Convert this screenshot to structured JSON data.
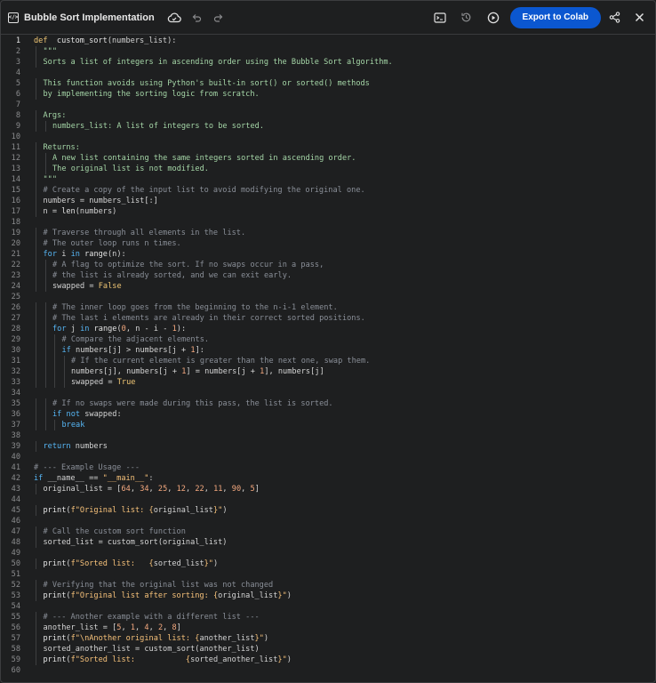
{
  "header": {
    "app_icon_glyph": "</>",
    "title": "Bubble Sort Implementation",
    "export_label": "Export to Colab",
    "icons": [
      "code-panel-icon",
      "cloud-sync-icon",
      "undo-icon",
      "redo-icon",
      "terminal-icon",
      "history-icon",
      "run-icon",
      "share-icon",
      "close-icon"
    ]
  },
  "colors": {
    "accent": "#0b57d0",
    "background": "#1e1f20",
    "keyword": "#f0c674",
    "comment": "#8a8f98",
    "docstring": "#a5d6a7",
    "number": "#f5a97f"
  },
  "editor": {
    "active_line": 1,
    "lines": [
      {
        "indent": 0,
        "tokens": [
          [
            "kw",
            "def"
          ],
          [
            "",
            "  "
          ],
          [
            "fn",
            "custom_sort"
          ],
          [
            "",
            "(numbers_list):"
          ]
        ]
      },
      {
        "indent": 1,
        "tokens": [
          [
            "doc",
            "\"\"\""
          ]
        ]
      },
      {
        "indent": 1,
        "tokens": [
          [
            "doc",
            "Sorts a list of integers in ascending order using the Bubble Sort algorithm."
          ]
        ]
      },
      {
        "indent": 0,
        "tokens": []
      },
      {
        "indent": 1,
        "tokens": [
          [
            "doc",
            "This function avoids using Python's built-in sort() or sorted() methods"
          ]
        ]
      },
      {
        "indent": 1,
        "tokens": [
          [
            "doc",
            "by implementing the sorting logic from scratch."
          ]
        ]
      },
      {
        "indent": 0,
        "tokens": []
      },
      {
        "indent": 1,
        "tokens": [
          [
            "doc",
            "Args:"
          ]
        ]
      },
      {
        "indent": 2,
        "tokens": [
          [
            "doc",
            "numbers_list: A list of integers to be sorted."
          ]
        ]
      },
      {
        "indent": 0,
        "tokens": []
      },
      {
        "indent": 1,
        "tokens": [
          [
            "doc",
            "Returns:"
          ]
        ]
      },
      {
        "indent": 2,
        "tokens": [
          [
            "doc",
            "A new list containing the same integers sorted in ascending order."
          ]
        ]
      },
      {
        "indent": 2,
        "tokens": [
          [
            "doc",
            "The original list is not modified."
          ]
        ]
      },
      {
        "indent": 1,
        "tokens": [
          [
            "doc",
            "\"\"\""
          ]
        ]
      },
      {
        "indent": 1,
        "tokens": [
          [
            "cm",
            "# Create a copy of the input list to avoid modifying the original one."
          ]
        ]
      },
      {
        "indent": 1,
        "tokens": [
          [
            "",
            "numbers = numbers_list[:]"
          ]
        ]
      },
      {
        "indent": 1,
        "tokens": [
          [
            "",
            "n = "
          ],
          [
            "fn",
            "len"
          ],
          [
            "",
            "(numbers)"
          ]
        ]
      },
      {
        "indent": 0,
        "tokens": []
      },
      {
        "indent": 1,
        "tokens": [
          [
            "cm",
            "# Traverse through all elements in the list."
          ]
        ]
      },
      {
        "indent": 1,
        "tokens": [
          [
            "cm",
            "# The outer loop runs n times."
          ]
        ]
      },
      {
        "indent": 1,
        "tokens": [
          [
            "kw2",
            "for"
          ],
          [
            "",
            " i "
          ],
          [
            "kw2",
            "in"
          ],
          [
            "",
            " "
          ],
          [
            "fn",
            "range"
          ],
          [
            "",
            "(n):"
          ]
        ]
      },
      {
        "indent": 2,
        "tokens": [
          [
            "cm",
            "# A flag to optimize the sort. If no swaps occur in a pass,"
          ]
        ]
      },
      {
        "indent": 2,
        "tokens": [
          [
            "cm",
            "# the list is already sorted, and we can exit early."
          ]
        ]
      },
      {
        "indent": 2,
        "tokens": [
          [
            "",
            "swapped = "
          ],
          [
            "kw",
            "False"
          ]
        ]
      },
      {
        "indent": 0,
        "tokens": []
      },
      {
        "indent": 2,
        "tokens": [
          [
            "cm",
            "# The inner loop goes from the beginning to the n-i-1 element."
          ]
        ]
      },
      {
        "indent": 2,
        "tokens": [
          [
            "cm",
            "# The last i elements are already in their correct sorted positions."
          ]
        ]
      },
      {
        "indent": 2,
        "tokens": [
          [
            "kw2",
            "for"
          ],
          [
            "",
            " j "
          ],
          [
            "kw2",
            "in"
          ],
          [
            "",
            " "
          ],
          [
            "fn",
            "range"
          ],
          [
            "",
            "("
          ],
          [
            "nm",
            "0"
          ],
          [
            "",
            ", n - i - "
          ],
          [
            "nm",
            "1"
          ],
          [
            "",
            "):"
          ]
        ]
      },
      {
        "indent": 3,
        "tokens": [
          [
            "cm",
            "# Compare the adjacent elements."
          ]
        ]
      },
      {
        "indent": 3,
        "tokens": [
          [
            "kw2",
            "if"
          ],
          [
            "",
            " numbers[j] > numbers[j + "
          ],
          [
            "nm",
            "1"
          ],
          [
            "",
            "]:"
          ]
        ]
      },
      {
        "indent": 4,
        "tokens": [
          [
            "cm",
            "# If the current element is greater than the next one, swap them."
          ]
        ]
      },
      {
        "indent": 4,
        "tokens": [
          [
            "",
            "numbers[j], numbers[j + "
          ],
          [
            "nm",
            "1"
          ],
          [
            "",
            "] = numbers[j + "
          ],
          [
            "nm",
            "1"
          ],
          [
            "",
            "], numbers[j]"
          ]
        ]
      },
      {
        "indent": 4,
        "tokens": [
          [
            "",
            "swapped = "
          ],
          [
            "kw",
            "True"
          ]
        ]
      },
      {
        "indent": 0,
        "tokens": []
      },
      {
        "indent": 2,
        "tokens": [
          [
            "cm",
            "# If no swaps were made during this pass, the list is sorted."
          ]
        ]
      },
      {
        "indent": 2,
        "tokens": [
          [
            "kw2",
            "if not"
          ],
          [
            "",
            " swapped:"
          ]
        ]
      },
      {
        "indent": 3,
        "tokens": [
          [
            "kw2",
            "break"
          ]
        ]
      },
      {
        "indent": 0,
        "tokens": []
      },
      {
        "indent": 1,
        "tokens": [
          [
            "kw2",
            "return"
          ],
          [
            "",
            " numbers"
          ]
        ]
      },
      {
        "indent": 0,
        "tokens": []
      },
      {
        "indent": 0,
        "tokens": [
          [
            "cm",
            "# --- Example Usage ---"
          ]
        ]
      },
      {
        "indent": 0,
        "tokens": [
          [
            "kw2",
            "if"
          ],
          [
            "",
            " __name__ == "
          ],
          [
            "st",
            "\"__main__\""
          ],
          [
            "",
            ":"
          ]
        ]
      },
      {
        "indent": 1,
        "tokens": [
          [
            "",
            "original_list = ["
          ],
          [
            "nm",
            "64"
          ],
          [
            "",
            ", "
          ],
          [
            "nm",
            "34"
          ],
          [
            "",
            ", "
          ],
          [
            "nm",
            "25"
          ],
          [
            "",
            ", "
          ],
          [
            "nm",
            "12"
          ],
          [
            "",
            ", "
          ],
          [
            "nm",
            "22"
          ],
          [
            "",
            ", "
          ],
          [
            "nm",
            "11"
          ],
          [
            "",
            ", "
          ],
          [
            "nm",
            "90"
          ],
          [
            "",
            ", "
          ],
          [
            "nm",
            "5"
          ],
          [
            "",
            "]"
          ]
        ]
      },
      {
        "indent": 0,
        "tokens": []
      },
      {
        "indent": 1,
        "tokens": [
          [
            "fn",
            "print"
          ],
          [
            "",
            "("
          ],
          [
            "st",
            "f\"Original list: {"
          ],
          [
            "",
            "original_list"
          ],
          [
            "st",
            "}\""
          ],
          [
            "",
            ")"
          ]
        ]
      },
      {
        "indent": 0,
        "tokens": []
      },
      {
        "indent": 1,
        "tokens": [
          [
            "cm",
            "# Call the custom sort function"
          ]
        ]
      },
      {
        "indent": 1,
        "tokens": [
          [
            "",
            "sorted_list = custom_sort(original_list)"
          ]
        ]
      },
      {
        "indent": 0,
        "tokens": []
      },
      {
        "indent": 1,
        "tokens": [
          [
            "fn",
            "print"
          ],
          [
            "",
            "("
          ],
          [
            "st",
            "f\"Sorted list:   {"
          ],
          [
            "",
            "sorted_list"
          ],
          [
            "st",
            "}\""
          ],
          [
            "",
            ")"
          ]
        ]
      },
      {
        "indent": 0,
        "tokens": []
      },
      {
        "indent": 1,
        "tokens": [
          [
            "cm",
            "# Verifying that the original list was not changed"
          ]
        ]
      },
      {
        "indent": 1,
        "tokens": [
          [
            "fn",
            "print"
          ],
          [
            "",
            "("
          ],
          [
            "st",
            "f\"Original list after sorting: {"
          ],
          [
            "",
            "original_list"
          ],
          [
            "st",
            "}\""
          ],
          [
            "",
            ")"
          ]
        ]
      },
      {
        "indent": 0,
        "tokens": []
      },
      {
        "indent": 1,
        "tokens": [
          [
            "cm",
            "# --- Another example with a different list ---"
          ]
        ]
      },
      {
        "indent": 1,
        "tokens": [
          [
            "",
            "another_list = ["
          ],
          [
            "nm",
            "5"
          ],
          [
            "",
            ", "
          ],
          [
            "nm",
            "1"
          ],
          [
            "",
            ", "
          ],
          [
            "nm",
            "4"
          ],
          [
            "",
            ", "
          ],
          [
            "nm",
            "2"
          ],
          [
            "",
            ", "
          ],
          [
            "nm",
            "8"
          ],
          [
            "",
            "]"
          ]
        ]
      },
      {
        "indent": 1,
        "tokens": [
          [
            "fn",
            "print"
          ],
          [
            "",
            "("
          ],
          [
            "st",
            "f\"\\nAnother original list: {"
          ],
          [
            "",
            "another_list"
          ],
          [
            "st",
            "}\""
          ],
          [
            "",
            ")"
          ]
        ]
      },
      {
        "indent": 1,
        "tokens": [
          [
            "",
            "sorted_another_list = custom_sort(another_list)"
          ]
        ]
      },
      {
        "indent": 1,
        "tokens": [
          [
            "fn",
            "print"
          ],
          [
            "",
            "("
          ],
          [
            "st",
            "f\"Sorted list:           {"
          ],
          [
            "",
            "sorted_another_list"
          ],
          [
            "st",
            "}\""
          ],
          [
            "",
            ")"
          ]
        ]
      },
      {
        "indent": 0,
        "tokens": []
      }
    ]
  }
}
